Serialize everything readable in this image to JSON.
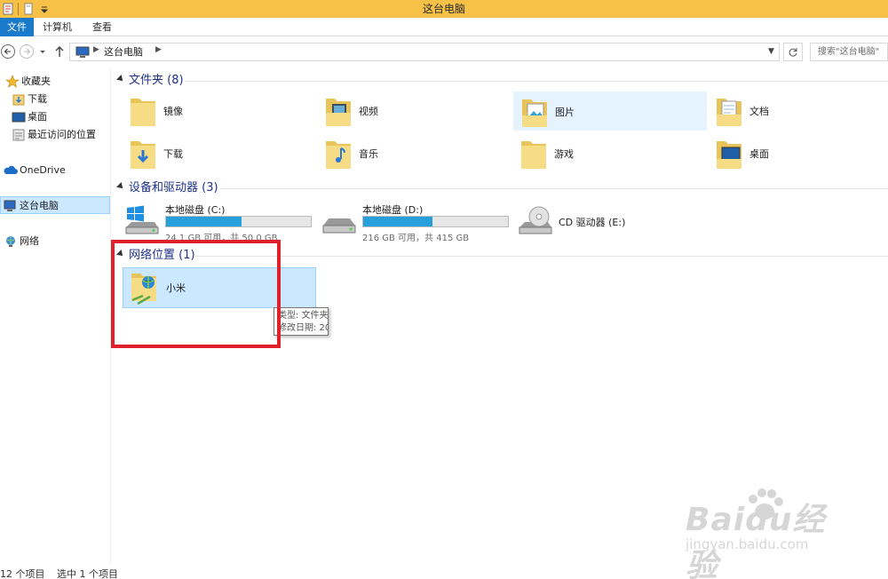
{
  "window": {
    "title": "这台电脑"
  },
  "ribbon": {
    "tabs": [
      "文件",
      "计算机",
      "查看"
    ]
  },
  "address": {
    "crumb": "这台电脑",
    "search_placeholder": "搜索\"这台电脑\""
  },
  "nav": {
    "favorites": "收藏夹",
    "fav_items": [
      "下载",
      "桌面",
      "最近访问的位置"
    ],
    "onedrive": "OneDrive",
    "thispc": "这台电脑",
    "network": "网络"
  },
  "groups": {
    "folders": "文件夹 (8)",
    "devices": "设备和驱动器 (3)",
    "network": "网络位置 (1)"
  },
  "folders": [
    "镜像",
    "视频",
    "图片",
    "文档",
    "下载",
    "音乐",
    "游戏",
    "桌面"
  ],
  "drives": [
    {
      "name": "本地磁盘 (C:)",
      "detail": "24.1 GB 可用，共 50.0 GB",
      "used_fraction": 0.52
    },
    {
      "name": "本地磁盘 (D:)",
      "detail": "216 GB 可用，共 415 GB",
      "used_fraction": 0.48
    },
    {
      "name": "CD 驱动器 (E:)"
    }
  ],
  "network_location": {
    "name": "小米"
  },
  "tooltip": {
    "line1": "类型: 文件夹",
    "line2": "修改日期: 20"
  },
  "status": {
    "count": "12 个项目",
    "selected": "选中 1 个项目"
  },
  "watermark": {
    "line1": "Baidu经验",
    "line2": "jingyan.baidu.com"
  },
  "colors": {
    "titlebar": "#f7c047",
    "file_tab": "#1979ca",
    "group_title": "#1e3287",
    "drive_fill": "#26a0da",
    "highlight": "#e0202a"
  }
}
